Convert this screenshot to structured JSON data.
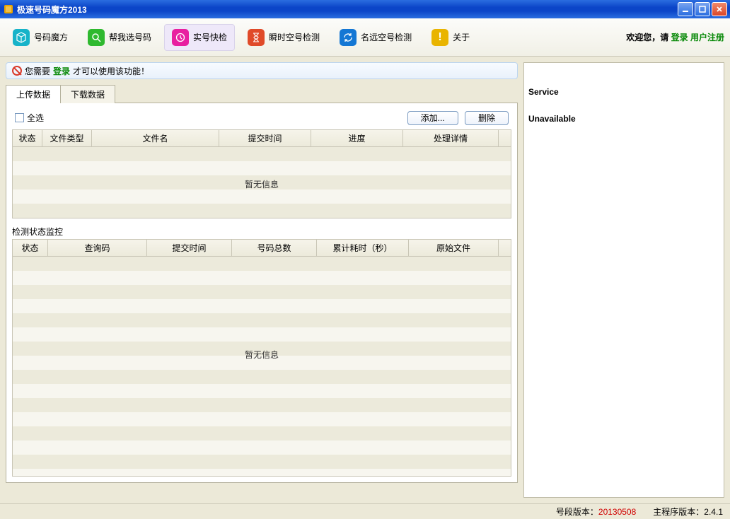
{
  "window": {
    "title": "极速号码魔方2013"
  },
  "toolbar": {
    "items": [
      {
        "label": "号码魔方",
        "color": "#17b3c9"
      },
      {
        "label": "帮我选号码",
        "color": "#2fb92f"
      },
      {
        "label": "实号快检",
        "color": "#e81fa0"
      },
      {
        "label": "瞬时空号检测",
        "color": "#e04a29"
      },
      {
        "label": "名远空号检测",
        "color": "#1477d4"
      },
      {
        "label": "关于",
        "color": "#e9b400"
      }
    ],
    "welcome_prefix": "欢迎您，请 ",
    "login_label": "登录",
    "register_label": "用户注册"
  },
  "notice": {
    "prefix": "您需要 ",
    "login_label": "登录",
    "suffix": " 才可以使用该功能！"
  },
  "tabs": {
    "upload": "上传数据",
    "download": "下载数据"
  },
  "upload": {
    "select_all": "全选",
    "add_btn": "添加...",
    "delete_btn": "删除",
    "columns": {
      "status": "状态",
      "filetype": "文件类型",
      "filename": "文件名",
      "submit_time": "提交时间",
      "progress": "进度",
      "detail": "处理详情"
    },
    "empty": "暂无信息"
  },
  "monitor": {
    "title": "检测状态监控",
    "columns": {
      "status": "状态",
      "query_code": "查询码",
      "submit_time": "提交时间",
      "total_numbers": "号码总数",
      "elapsed": "累计耗时（秒）",
      "source_file": "原始文件"
    },
    "empty": "暂无信息"
  },
  "sidebar": {
    "message_line1": "Service",
    "message_line2": "Unavailable"
  },
  "statusbar": {
    "seg_label": "号段版本：",
    "seg_value": "20130508",
    "app_label": "主程序版本：",
    "app_value": "2.4.1"
  }
}
